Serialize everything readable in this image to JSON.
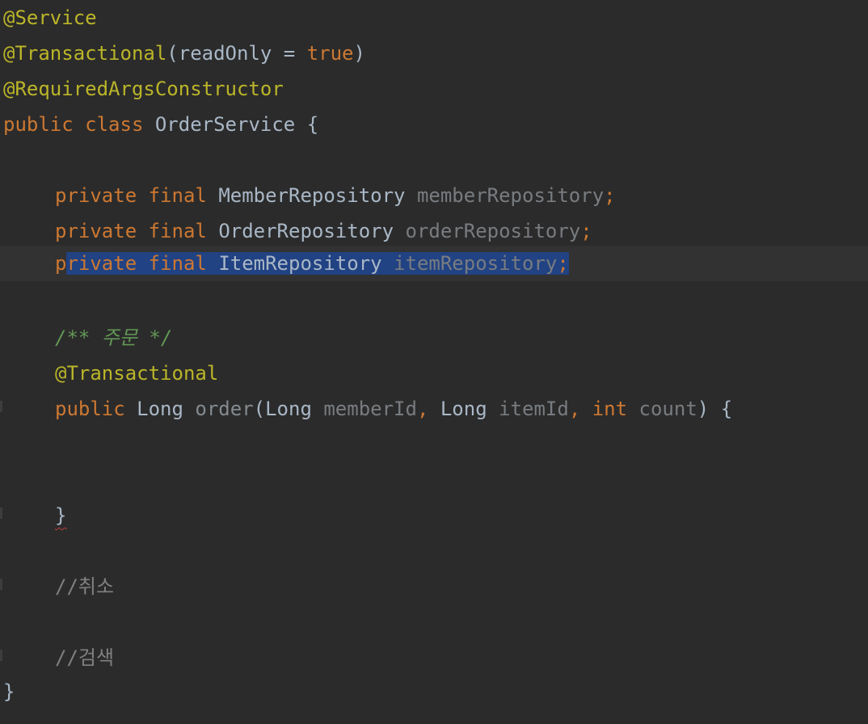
{
  "editor": {
    "lines": {
      "l1": {
        "anno": "@Service"
      },
      "l2": {
        "anno": "@Transactional",
        "paren_open": "(",
        "attr": "readOnly",
        "eq": " = ",
        "val": "true",
        "paren_close": ")"
      },
      "l3": {
        "anno": "@RequiredArgsConstructor"
      },
      "l4": {
        "kw_public": "public",
        "kw_class": "class",
        "class_name": "OrderService",
        "brace": "{"
      },
      "l6": {
        "kw_private": "private",
        "kw_final": "final",
        "type": "MemberRepository",
        "name": "memberRepository",
        "semi": ";"
      },
      "l7": {
        "kw_private": "private",
        "kw_final": "final",
        "type": "OrderRepository",
        "name": "orderRepository",
        "semi": ";"
      },
      "l8": {
        "kw_private_first": "p",
        "kw_private_rest": "rivate",
        "kw_final": "final",
        "type": "ItemRepository",
        "name": "itemRepository",
        "semi": ";"
      },
      "l10": {
        "doc": "/** 주문 */"
      },
      "l11": {
        "anno": "@Transactional"
      },
      "l12": {
        "kw_public": "public",
        "ret_type": "Long",
        "method": "order",
        "paren_open": "(",
        "p1_type": "Long",
        "p1_name": "memberId",
        "comma1": ",",
        "p2_type": "Long",
        "p2_name": "itemId",
        "comma2": ",",
        "p3_type": "int",
        "p3_name": "count",
        "paren_close": ")",
        "brace": "{"
      },
      "l15": {
        "brace": "}"
      },
      "l17": {
        "comment": "//취소"
      },
      "l19": {
        "comment": "//검색"
      },
      "l20": {
        "brace": "}"
      }
    },
    "colors": {
      "background": "#2b2b2b",
      "selection": "#214283",
      "annotation": "#bbb529",
      "keyword": "#cc7832",
      "doc_comment": "#629755",
      "line_comment": "#808080"
    }
  }
}
